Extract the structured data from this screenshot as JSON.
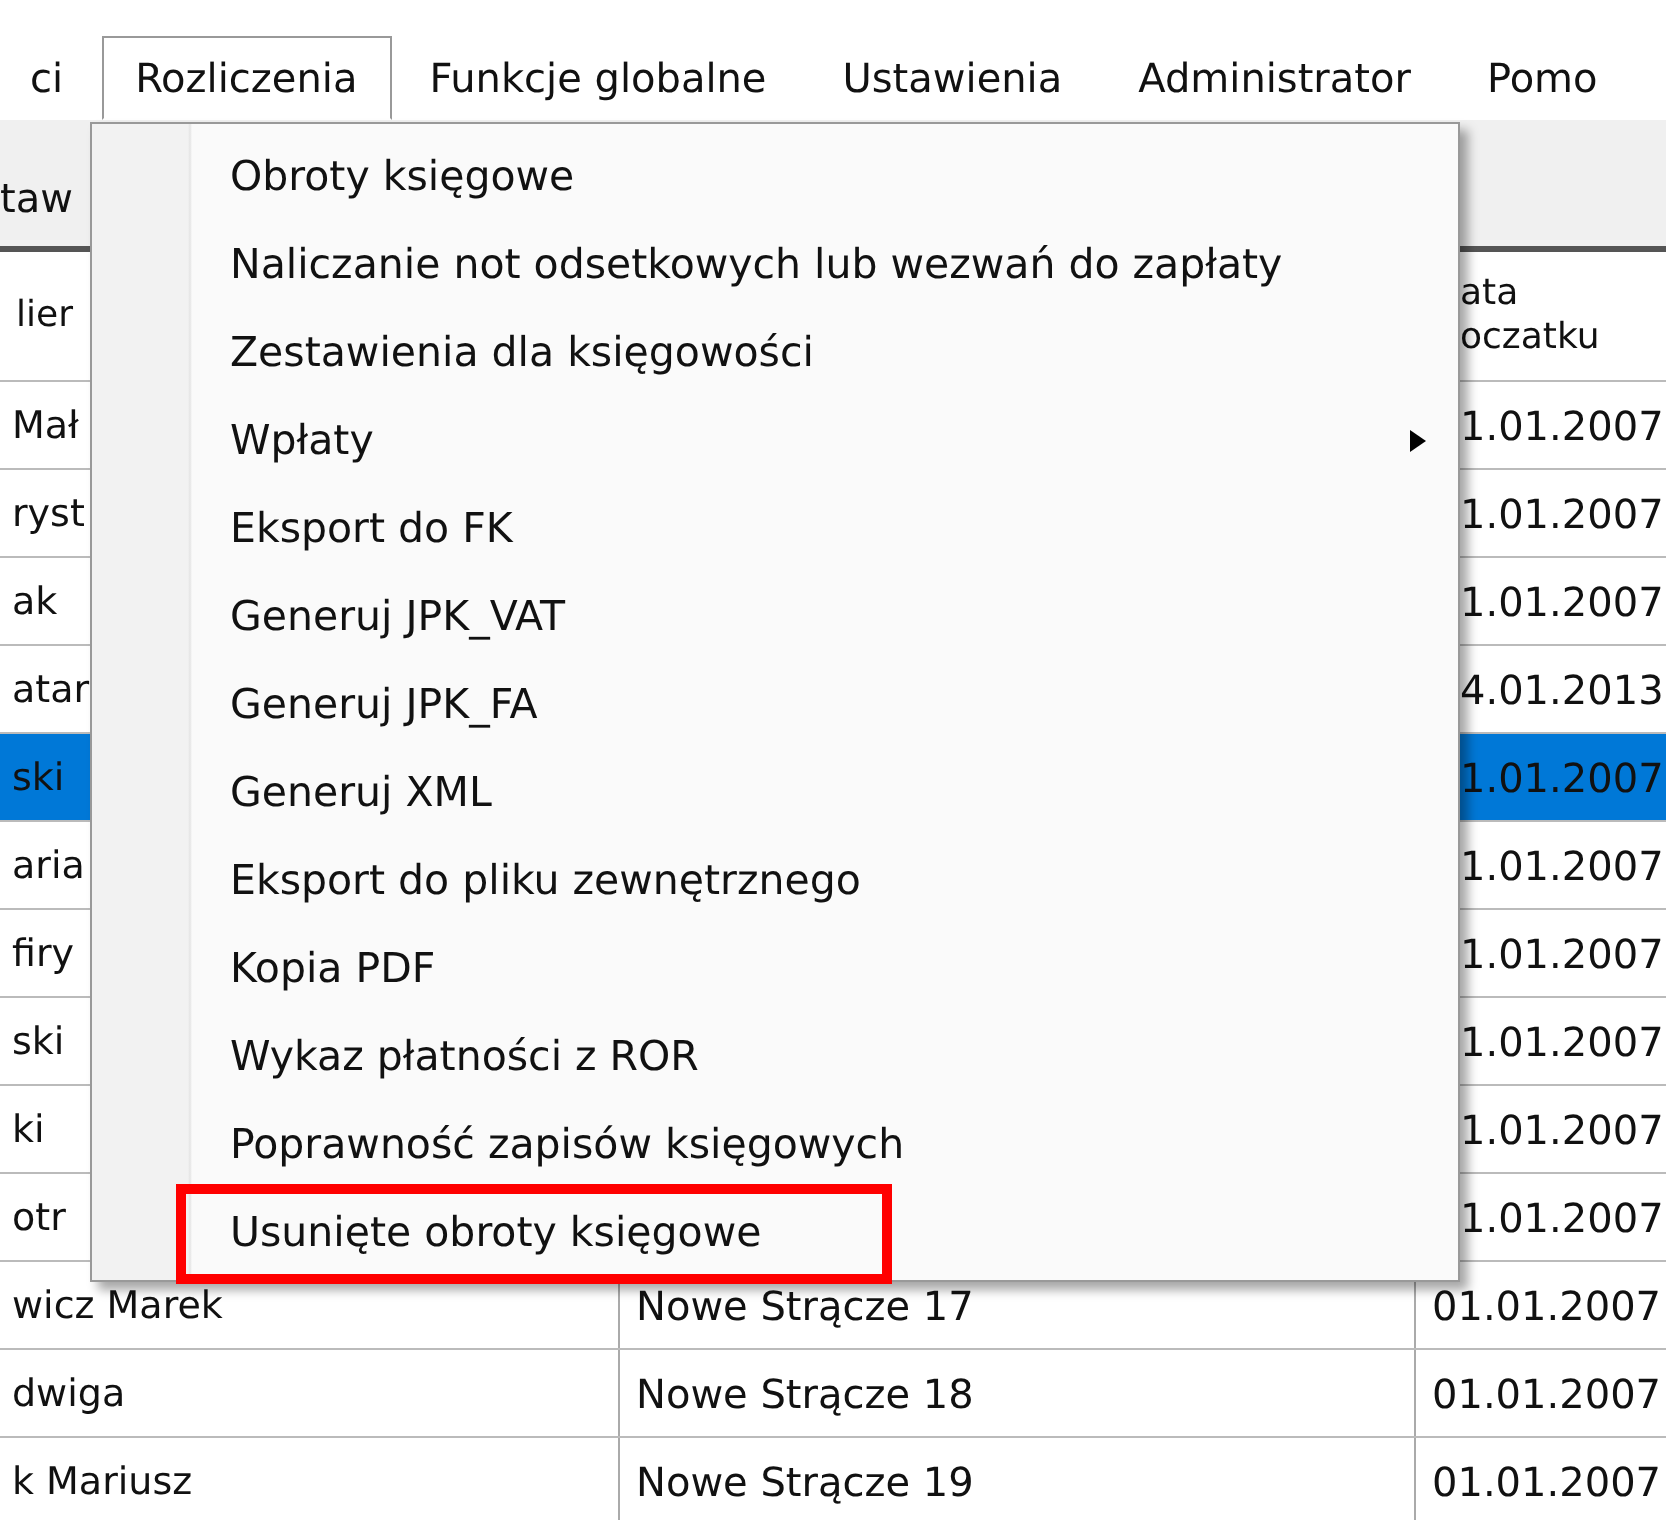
{
  "menubar": [
    {
      "label": "ci",
      "selected": false
    },
    {
      "label": "Rozliczenia",
      "selected": true
    },
    {
      "label": "Funkcje globalne",
      "selected": false
    },
    {
      "label": "Ustawienia",
      "selected": false
    },
    {
      "label": "Administrator",
      "selected": false
    },
    {
      "label": "Pomo",
      "selected": false
    }
  ],
  "toolbar": {
    "label": "taw"
  },
  "table": {
    "columns": [
      {
        "lines": [
          "lier"
        ]
      },
      {
        "lines": [
          "ata",
          "oczatku"
        ]
      }
    ],
    "rows": [
      {
        "column_1": "Mał",
        "column_3": "1.01.2007",
        "selected": false
      },
      {
        "column_1": "ryst",
        "column_3": "1.01.2007",
        "selected": false
      },
      {
        "column_1": "ak",
        "column_3": "1.01.2007",
        "selected": false
      },
      {
        "column_1": "atar",
        "column_3": "4.01.2013",
        "selected": false
      },
      {
        "column_1": "ski",
        "column_3": "1.01.2007",
        "selected": true
      },
      {
        "column_1": "aria",
        "column_3": "1.01.2007",
        "selected": false
      },
      {
        "column_1": "firy",
        "column_3": "1.01.2007",
        "selected": false
      },
      {
        "column_1": "ski",
        "column_3": "1.01.2007",
        "selected": false
      },
      {
        "column_1": "ki",
        "column_3": "1.01.2007",
        "selected": false
      },
      {
        "column_1": "otr",
        "column_3": "1.01.2007",
        "selected": false
      },
      {
        "column_1": "wicz Marek",
        "column_2": "Nowe Strącze 17",
        "column_3": "01.01.2007",
        "selected": false
      },
      {
        "column_1": "dwiga",
        "column_2": "Nowe Strącze 18",
        "column_3": "01.01.2007",
        "selected": false
      },
      {
        "column_1": "k Mariusz",
        "column_2": "Nowe Strącze 19",
        "column_3": "01.01.2007",
        "selected": false
      }
    ]
  },
  "dropdown": {
    "items": [
      {
        "label": "Obroty księgowe",
        "submenu": false,
        "highlighted": false
      },
      {
        "label": "Naliczanie not odsetkowych lub wezwań do zapłaty",
        "submenu": false,
        "highlighted": false
      },
      {
        "label": "Zestawienia dla księgowości",
        "submenu": false,
        "highlighted": false
      },
      {
        "label": "Wpłaty",
        "submenu": true,
        "highlighted": false
      },
      {
        "label": "Eksport do FK",
        "submenu": false,
        "highlighted": false
      },
      {
        "label": "Generuj JPK_VAT",
        "submenu": false,
        "highlighted": false
      },
      {
        "label": "Generuj JPK_FA",
        "submenu": false,
        "highlighted": false
      },
      {
        "label": "Generuj XML",
        "submenu": false,
        "highlighted": false
      },
      {
        "label": "Eksport do pliku zewnętrznego",
        "submenu": false,
        "highlighted": false
      },
      {
        "label": "Kopia PDF",
        "submenu": false,
        "highlighted": false
      },
      {
        "label": "Wykaz płatności z ROR",
        "submenu": false,
        "highlighted": false
      },
      {
        "label": "Poprawność zapisów księgowych",
        "submenu": false,
        "highlighted": false
      },
      {
        "label": "Usunięte obroty księgowe",
        "submenu": false,
        "highlighted": true
      }
    ]
  }
}
